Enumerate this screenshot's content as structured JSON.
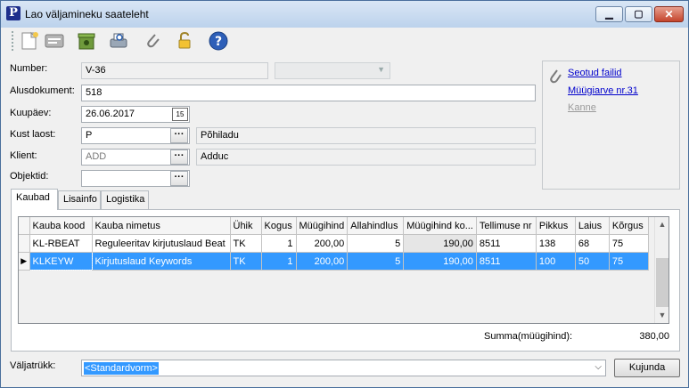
{
  "window": {
    "title": "Lao väljamineku saateleht"
  },
  "form": {
    "number_label": "Number:",
    "number_value": "V-36",
    "alusdokument_label": "Alusdokument:",
    "alusdokument_value": "518",
    "kuupaev_label": "Kuupäev:",
    "kuupaev_value": "26.06.2017",
    "kust_laost_label": "Kust laost:",
    "kust_laost_value": "P",
    "kust_laost_name": "Põhiladu",
    "klient_label": "Klient:",
    "klient_value": "ADD",
    "klient_name": "Adduc",
    "objektid_label": "Objektid:",
    "objektid_value": ""
  },
  "links": {
    "seotud_failid": "Seotud failid",
    "muugiarve": "Müügiarve nr.31",
    "kanne": "Kanne"
  },
  "tabs": [
    "Kaubad",
    "Lisainfo",
    "Logistika"
  ],
  "grid": {
    "columns": [
      "Kauba kood",
      "Kauba nimetus",
      "Ühik",
      "Kogus",
      "Müügihind",
      "Allahindlus",
      "Müügihind ko...",
      "Tellimuse nr",
      "Pikkus",
      "Laius",
      "Kõrgus"
    ],
    "rows": [
      [
        "KL-RBEAT",
        "Reguleeritav kirjutuslaud Beat",
        "TK",
        "1",
        "200,00",
        "5",
        "190,00",
        "8511",
        "138",
        "68",
        "75"
      ],
      [
        "KLKEYW",
        "Kirjutuslaud Keywords",
        "TK",
        "1",
        "200,00",
        "5",
        "190,00",
        "8511",
        "100",
        "50",
        "75"
      ]
    ]
  },
  "summary": {
    "label": "Summa(müügihind):",
    "value": "380,00"
  },
  "footer": {
    "valjatrukk_label": "Väljatrükk:",
    "valjatrukk_value": "<Standardvorm>",
    "kujunda_label": "Kujunda"
  },
  "icons": {
    "toolbar": [
      "new-document-icon",
      "edit-icon",
      "delete-icon",
      "print-preview-icon",
      "attach-icon",
      "unlock-icon",
      "help-icon"
    ]
  },
  "colors": {
    "selection": "#3399ff",
    "link": "#0000cc"
  }
}
